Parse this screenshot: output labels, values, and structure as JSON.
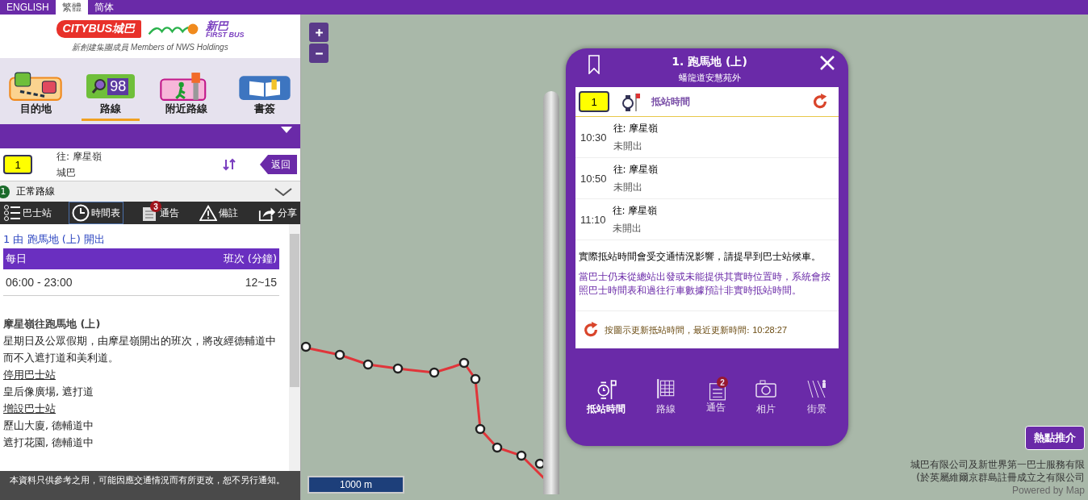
{
  "languages": [
    {
      "label": "ENGLISH",
      "selected": false
    },
    {
      "label": "繁體",
      "selected": true
    },
    {
      "label": "简体",
      "selected": false
    }
  ],
  "logo": {
    "citybus": "CITYBUS城巴",
    "firstbus": "新巴",
    "firstbus_en": "FIRST BUS",
    "tagline": "新創建集團成員 Members of NWS Holdings"
  },
  "nav": [
    {
      "label": "目的地",
      "kind": "destination",
      "selected": false
    },
    {
      "label": "路線",
      "kind": "route",
      "badge": "98",
      "selected": true
    },
    {
      "label": "附近路線",
      "kind": "nearby",
      "selected": false
    },
    {
      "label": "書簽",
      "kind": "bookmark",
      "selected": false
    }
  ],
  "route": {
    "number": "1",
    "destination": "往: 摩星嶺",
    "operator": "城巴",
    "back": "返回"
  },
  "variant": {
    "index": "1",
    "label": "正常路線"
  },
  "tools": [
    {
      "label": "巴士站",
      "kind": "stops",
      "selected": false
    },
    {
      "label": "時間表",
      "kind": "timetable",
      "selected": true
    },
    {
      "label": "通告",
      "kind": "notice",
      "badge": "3",
      "selected": false
    },
    {
      "label": "備註",
      "kind": "remark",
      "selected": false
    },
    {
      "label": "分享",
      "kind": "share",
      "selected": false
    }
  ],
  "timetable": {
    "heading": "1 由 跑馬地 (上) 開出",
    "columns": [
      "每日",
      "班次 (分鐘)"
    ],
    "rows": [
      {
        "period": "06:00 - 23:00",
        "freq": "12~15"
      }
    ]
  },
  "notes": [
    {
      "kind": "title",
      "text": "摩星嶺往跑馬地 (上)"
    },
    {
      "kind": "text",
      "text": "星期日及公眾假期，由摩星嶺開出的班次，將改經德輔道中而不入遮打道和美利道。"
    },
    {
      "kind": "link",
      "text": "停用巴士站"
    },
    {
      "kind": "text",
      "text": "皇后像廣場, 遮打道"
    },
    {
      "kind": "link",
      "text": "增設巴士站"
    },
    {
      "kind": "text",
      "text": "歷山大廈, 德輔道中"
    },
    {
      "kind": "text",
      "text": "遮打花園, 德輔道中"
    }
  ],
  "disclaimer": "本資料只供參考之用，可能因應交通情況而有所更改，恕不另行通知。",
  "map": {
    "scale": "1000 m",
    "hotspot": "熱點推介",
    "copyright": [
      "城巴有限公司及新世界第一巴士服務有限",
      "(於英屬維爾京群島註冊成立之有限公司"
    ],
    "powered": "Powered by Map"
  },
  "popup": {
    "title": "1. 跑馬地 (上)",
    "subtitle": "蟠龍道安慧苑外",
    "route": "1",
    "section": "抵站時間",
    "etas": [
      {
        "time": "10:30",
        "dest": "往: 摩星嶺",
        "status": "未開出"
      },
      {
        "time": "10:50",
        "dest": "往: 摩星嶺",
        "status": "未開出"
      },
      {
        "time": "11:10",
        "dest": "往: 摩星嶺",
        "status": "未開出"
      }
    ],
    "note": "實際抵站時間會受交通情況影響，請提早到巴士站候車。",
    "note2": "當巴士仍未從總站出發或未能提供其實時位置時，系統會按照巴士時間表和過往行車數據預計非實時抵站時間。",
    "refresh": "按圖示更新抵站時間，最近更新時間:",
    "updated": "10:28:27",
    "tabs": [
      {
        "label": "抵站時間",
        "kind": "eta",
        "selected": true
      },
      {
        "label": "路線",
        "kind": "route",
        "selected": false
      },
      {
        "label": "通告",
        "kind": "notice",
        "badge": "2",
        "selected": false
      },
      {
        "label": "相片",
        "kind": "photo",
        "selected": false
      },
      {
        "label": "街景",
        "kind": "street",
        "selected": false
      }
    ]
  }
}
